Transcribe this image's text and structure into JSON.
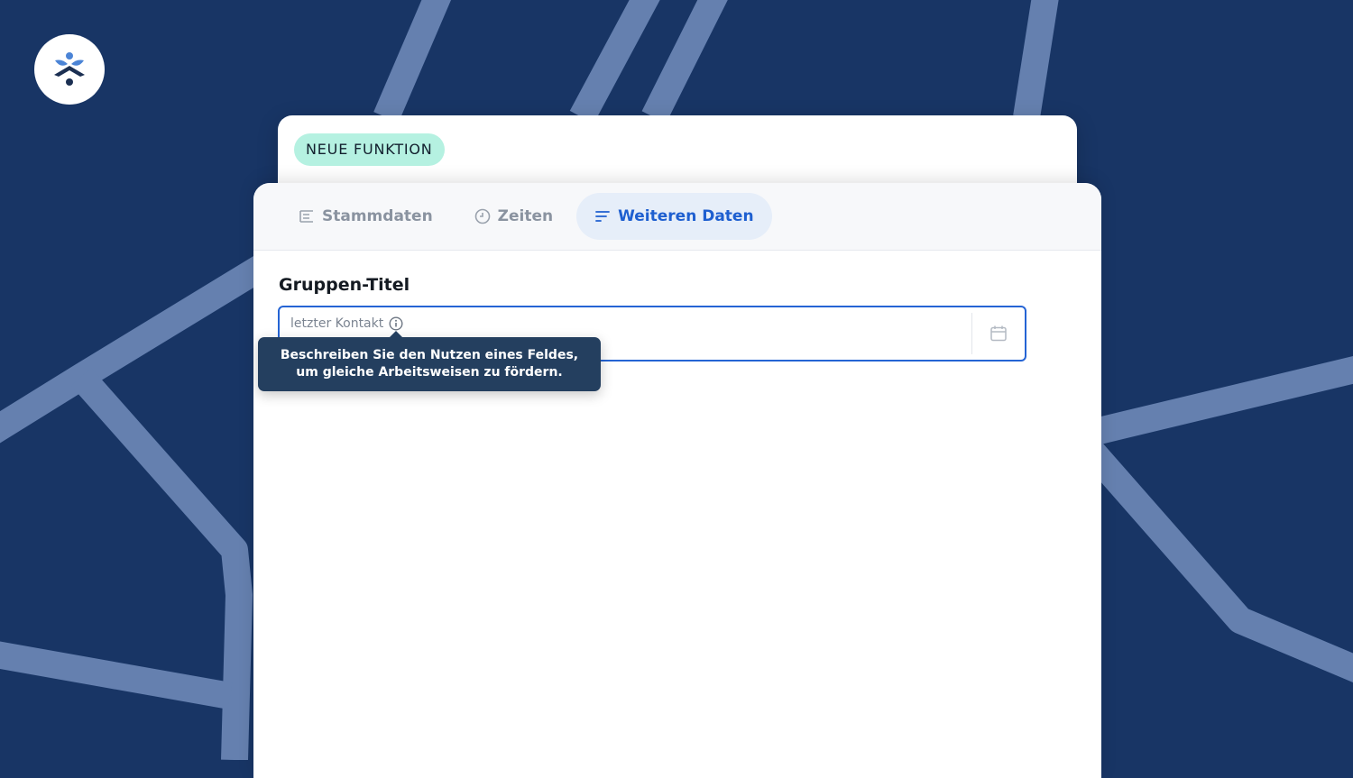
{
  "badge": {
    "label": "NEUE FUNKTION"
  },
  "tabs": [
    {
      "label": "Stammdaten",
      "icon": "list-icon",
      "active": false
    },
    {
      "label": "Zeiten",
      "icon": "clock-icon",
      "active": false
    },
    {
      "label": "Weiteren Daten",
      "icon": "lines-icon",
      "active": true
    }
  ],
  "section": {
    "title": "Gruppen-Titel"
  },
  "field": {
    "label": "letzter Kontakt",
    "value": "",
    "icon": "calendar-icon",
    "info_icon": "info-icon"
  },
  "tooltip": {
    "text": "Beschreiben Sie den Nutzen eines Feldes, um gleiche Arbeitsweisen zu fördern."
  },
  "colors": {
    "background": "#183565",
    "line": "#6580af",
    "accent": "#2564d4",
    "badge": "#b5f1e1",
    "tooltip": "#243f5f"
  }
}
